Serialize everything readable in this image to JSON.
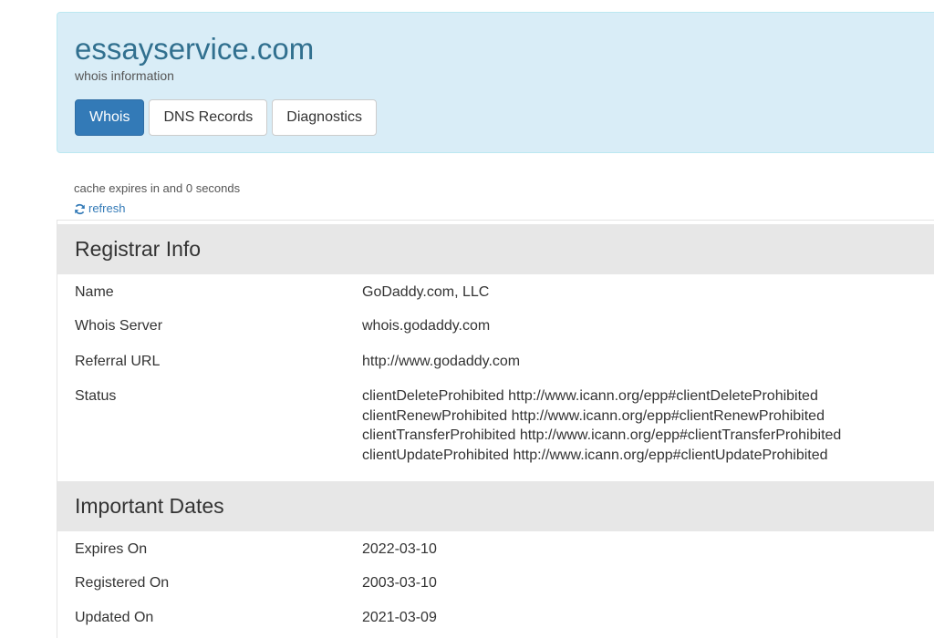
{
  "header": {
    "domain": "essayservice.com",
    "subtitle": "whois information",
    "tabs": [
      {
        "label": "Whois",
        "active": true
      },
      {
        "label": "DNS Records",
        "active": false
      },
      {
        "label": "Diagnostics",
        "active": false
      }
    ]
  },
  "cache": {
    "text": "cache expires in and 0 seconds",
    "refresh_label": "refresh",
    "refresh_icon": "refresh-icon"
  },
  "registrar": {
    "title": "Registrar Info",
    "rows": [
      {
        "label": "Name",
        "value": "GoDaddy.com, LLC"
      },
      {
        "label": "Whois Server",
        "value": "whois.godaddy.com"
      },
      {
        "label": "Referral URL",
        "value": "http://www.godaddy.com"
      }
    ],
    "status_label": "Status",
    "status_values": [
      "clientDeleteProhibited http://www.icann.org/epp#clientDeleteProhibited",
      "clientRenewProhibited http://www.icann.org/epp#clientRenewProhibited",
      "clientTransferProhibited http://www.icann.org/epp#clientTransferProhibited",
      "clientUpdateProhibited http://www.icann.org/epp#clientUpdateProhibited"
    ]
  },
  "dates": {
    "title": "Important Dates",
    "rows": [
      {
        "label": "Expires On",
        "value": "2022-03-10"
      },
      {
        "label": "Registered On",
        "value": "2003-03-10"
      },
      {
        "label": "Updated On",
        "value": "2021-03-09"
      }
    ]
  },
  "colors": {
    "header_bg": "#d9edf7",
    "title": "#31708f",
    "active_tab": "#337ab7",
    "section_bg": "#e7e7e7",
    "link": "#337ab7"
  }
}
